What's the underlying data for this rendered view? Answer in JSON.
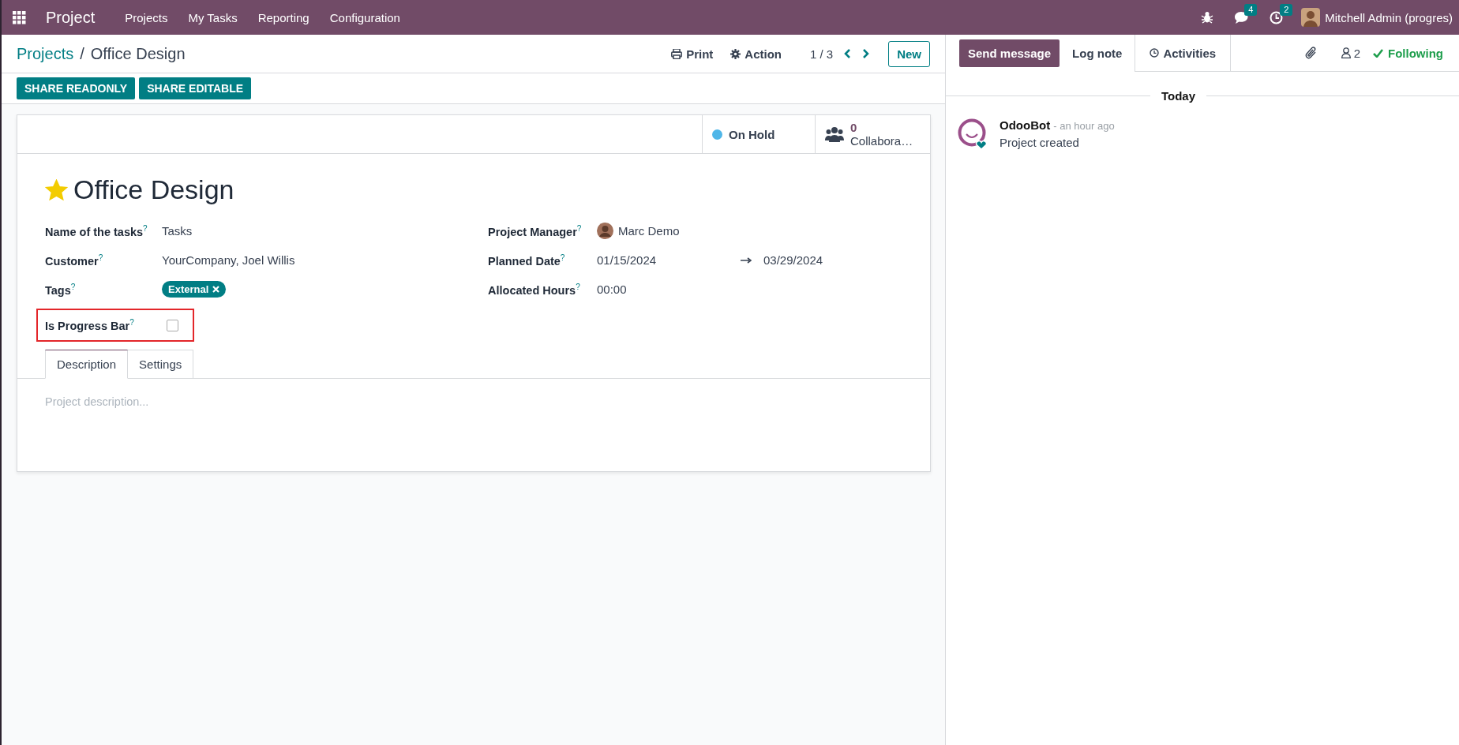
{
  "navbar": {
    "app": "Project",
    "menus": [
      "Projects",
      "My Tasks",
      "Reporting",
      "Configuration"
    ],
    "messages_badge": "4",
    "activities_badge": "2",
    "user": "Mitchell Admin (progres)"
  },
  "control_panel": {
    "breadcrumbs": [
      "Projects",
      "Office Design"
    ],
    "breadcrumb_separator": "/",
    "print": "Print",
    "action": "Action",
    "pager": "1 / 3",
    "new_button": "New"
  },
  "share_buttons": [
    "SHARE READONLY",
    "SHARE EDITABLE"
  ],
  "form": {
    "status": {
      "label": "On Hold",
      "color": "#4fb6e8"
    },
    "collaborators": {
      "count": "0",
      "label": "Collabora…"
    },
    "favorite": true,
    "title": "Office Design",
    "left_fields": [
      {
        "kind": "text",
        "label": "Name of the tasks$^{?}$",
        "value": "Tasks"
      },
      {
        "kind": "text",
        "label": "Customer$^{?}$",
        "value": "YourCompany, Joel Willis"
      },
      {
        "kind": "tags",
        "label": "Tags$^{?}$",
        "tags": [
          "External"
        ]
      },
      {
        "kind": "checkbox",
        "label": "Is Progress Bar$^{?}$",
        "checked": false,
        "highlighted": true
      }
    ],
    "right_fields": [
      {
        "kind": "user",
        "label": "Project Manager$^{?}$",
        "value": "Marc Demo"
      },
      {
        "kind": "daterange",
        "label": "Planned Date$^{?}$",
        "start": "01/15/2024",
        "end": "03/29/2024"
      },
      {
        "kind": "text",
        "label": "Allocated Hours$^{?}$",
        "value": "00:00"
      }
    ],
    "tabs": [
      {
        "label": "Description",
        "selected": true
      },
      {
        "label": "Settings",
        "selected": false
      }
    ],
    "description_placeholder": "Project description..."
  },
  "chatter": {
    "buttons": [
      {
        "label": "Send message",
        "kind": "primary"
      },
      {
        "label": "Log note",
        "kind": "plain"
      },
      {
        "label": "Activities",
        "kind": "tab"
      }
    ],
    "followers_count": "2",
    "following": "Following",
    "date_divider": "Today",
    "messages": [
      {
        "author": "OdooBot",
        "time": "- an hour ago",
        "body": "Project created"
      }
    ]
  }
}
